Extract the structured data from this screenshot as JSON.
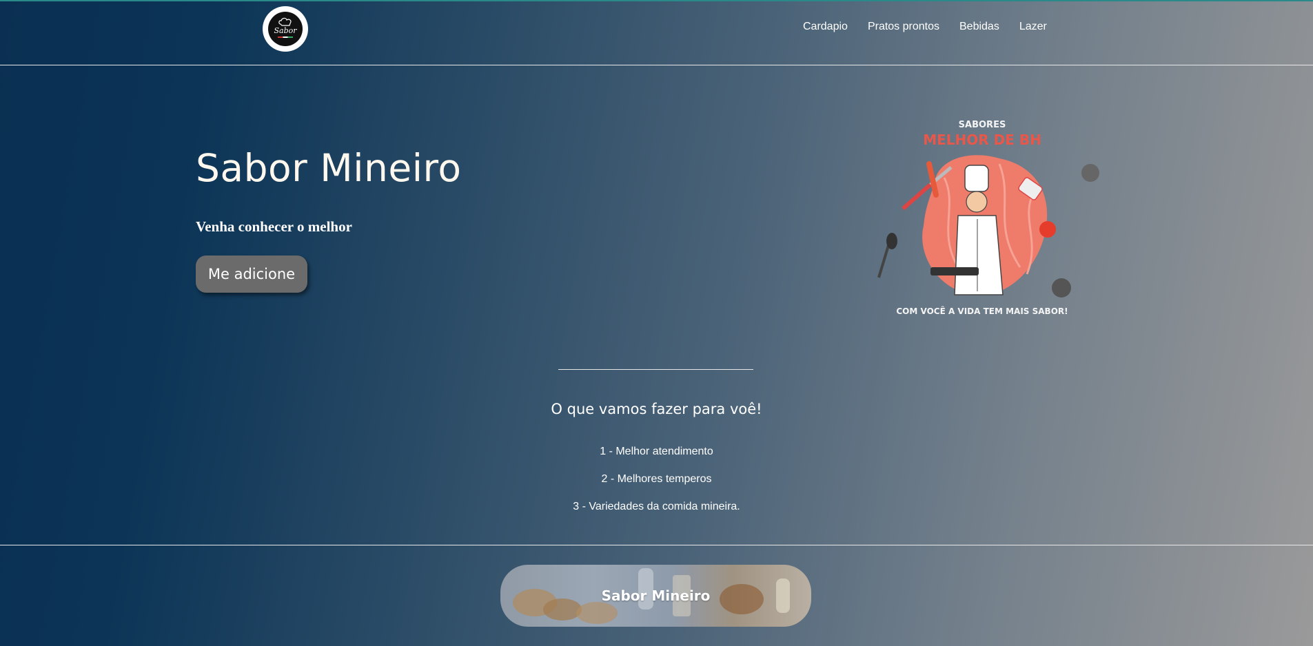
{
  "header": {
    "logo_text": "Sabor",
    "nav": [
      "Cardapio",
      "Pratos prontos",
      "Bebidas",
      "Lazer"
    ]
  },
  "hero": {
    "title": "Sabor Mineiro",
    "subtitle": "Venha conhecer o melhor",
    "button": "Me adicione"
  },
  "promo": {
    "top": "SABORES",
    "headline": "MELHOR DE BH",
    "bottom": "COM VOCÊ A VIDA TEM MAIS SABOR!"
  },
  "section": {
    "title": "O que vamos fazer para voê!",
    "items": [
      "1 - Melhor atendimento",
      "2 - Melhores temperos",
      "3 - Variedades da comida mineira."
    ]
  },
  "footer": {
    "banner_text": "Sabor Mineiro"
  }
}
